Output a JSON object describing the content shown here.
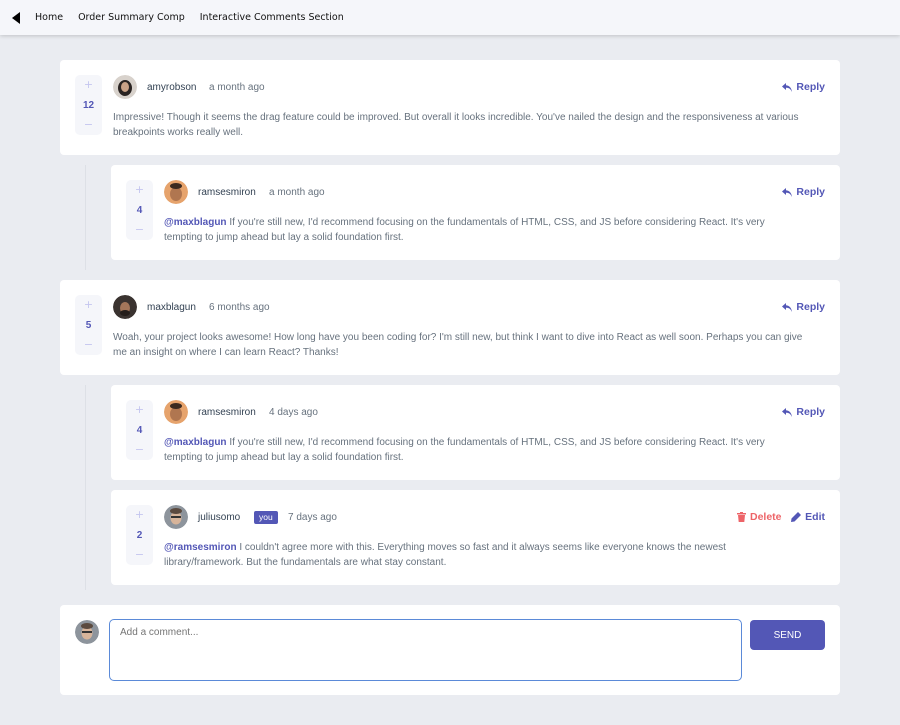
{
  "nav": {
    "links": [
      "Home",
      "Order Summary Comp",
      "Interactive Comments Section"
    ]
  },
  "colors": {
    "accent": "#5357b6",
    "danger": "#ed6468",
    "background": "#eaecf1",
    "vote_bg": "#f5f6fa"
  },
  "comments": [
    {
      "score": "12",
      "username": "amyrobson",
      "time": "a month ago",
      "action": "Reply",
      "mention": "",
      "text": "Impressive! Though it seems the drag feature could be improved. But overall it looks incredible. You've nailed the design and the responsiveness at various breakpoints works really well."
    },
    {
      "score": "4",
      "username": "ramsesmiron",
      "time": "a month ago",
      "action": "Reply",
      "mention": "@maxblagun",
      "text": " If you're still new, I'd recommend focusing on the fundamentals of HTML, CSS, and JS before considering React. It's very tempting to jump ahead but lay a solid foundation first."
    },
    {
      "score": "5",
      "username": "maxblagun",
      "time": "6 months ago",
      "action": "Reply",
      "mention": "",
      "text": "Woah, your project looks awesome! How long have you been coding for? I'm still new, but think I want to dive into React as well soon. Perhaps you can give me an insight on where I can learn React? Thanks!"
    },
    {
      "score": "4",
      "username": "ramsesmiron",
      "time": "4 days ago",
      "action": "Reply",
      "mention": "@maxblagun",
      "text": " If you're still new, I'd recommend focusing on the fundamentals of HTML, CSS, and JS before considering React. It's very tempting to jump ahead but lay a solid foundation first."
    },
    {
      "score": "2",
      "username": "juliusomo",
      "badge": "you",
      "time": "7 days ago",
      "delete_label": "Delete",
      "edit_label": "Edit",
      "mention": "@ramsesmiron",
      "text": " I couldn't agree more with this. Everything moves so fast and it always seems like everyone knows the newest library/framework. But the fundamentals are what stay constant."
    }
  ],
  "vote": {
    "plus": "+",
    "minus": "−"
  },
  "composer": {
    "placeholder": "Add a comment...",
    "send_label": "SEND"
  }
}
